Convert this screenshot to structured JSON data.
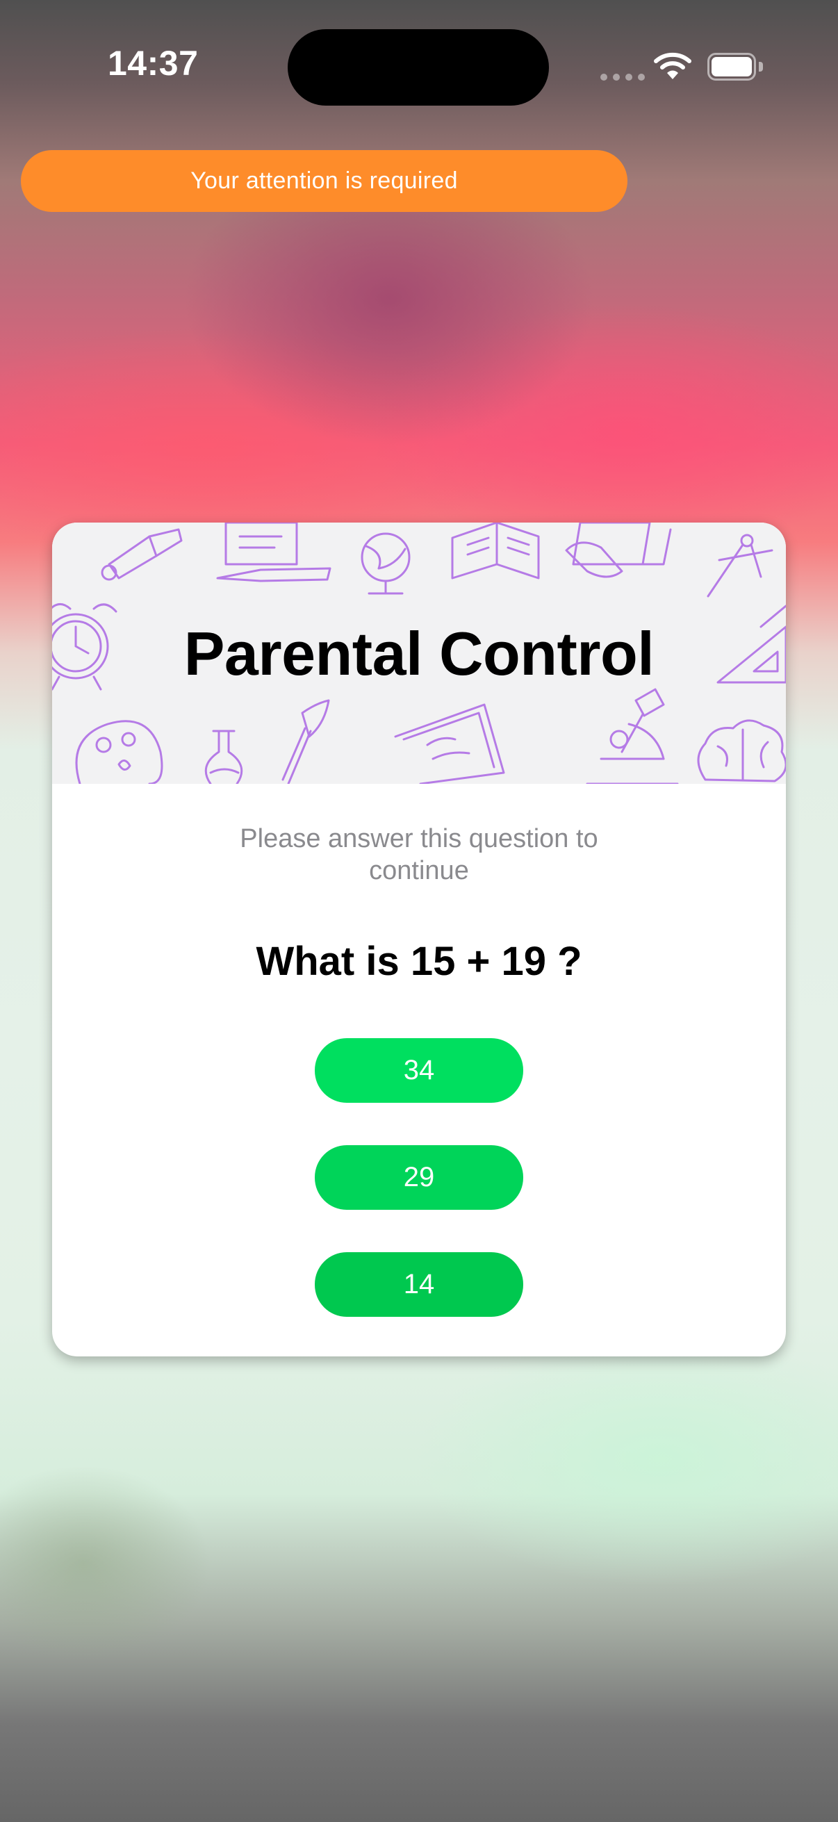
{
  "status_bar": {
    "time": "14:37",
    "icons": [
      "cellular-signal-icon",
      "wifi-icon",
      "battery-icon"
    ]
  },
  "banner": {
    "text": "Your attention is required",
    "color": "#fe8c2a"
  },
  "card": {
    "title": "Parental Control",
    "header_doodles": [
      "paint-tube-icon",
      "laptop-book-icon",
      "globe-icon",
      "open-book-icon",
      "tablet-hand-icon",
      "compass-icon",
      "alarm-clock-icon",
      "triangle-ruler-icon",
      "palette-icon",
      "flask-icon",
      "paintbrush-icon",
      "chalkboard-icon",
      "microscope-icon",
      "brain-icon"
    ],
    "doodle_color": "#b57be6",
    "instruction": "Please answer this question to continue",
    "question": "What is 15 + 19 ?",
    "answers": [
      "34",
      "29",
      "14"
    ],
    "answer_color": "#00d459"
  }
}
